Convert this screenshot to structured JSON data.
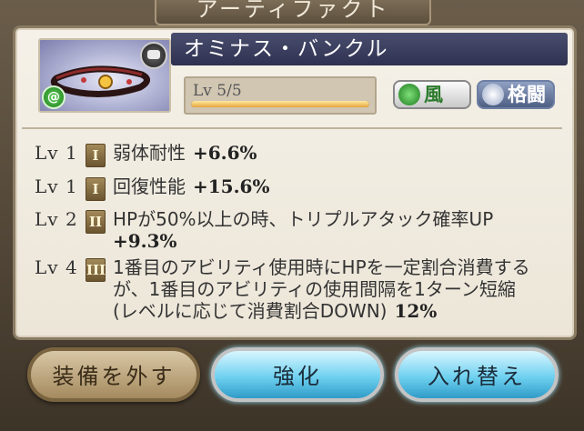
{
  "window_title": "アーティファクト",
  "item": {
    "name": "オミナス・バンクル",
    "level_label": "Lv 5/5",
    "level_progress": 1.0,
    "thumbnail_icon": "bangle-artifact-icon",
    "element_badge_icon": "wind-element-icon",
    "element_label": "風",
    "weapon_type_label": "格闘"
  },
  "skills": [
    {
      "lv": "Lv 1",
      "rank": "I",
      "desc": "弱体耐性",
      "value": "+6.6%"
    },
    {
      "lv": "Lv 1",
      "rank": "I",
      "desc": "回復性能",
      "value": "+15.6%"
    },
    {
      "lv": "Lv 2",
      "rank": "II",
      "desc": "HPが50%以上の時、トリプルアタック確率UP",
      "value": "+9.3%"
    },
    {
      "lv": "Lv 4",
      "rank": "III",
      "desc": "1番目のアビリティ使用時にHPを一定割合消費するが、1番目のアビリティの使用間隔を1ターン短縮(レベルに応じて消費割合DOWN)",
      "value": "12%"
    }
  ],
  "buttons": {
    "unequip": "装備を外す",
    "upgrade": "強化",
    "swap": "入れ替え"
  },
  "colors": {
    "header": "#2e3150",
    "panel": "#f2ede2",
    "button_blue": "#6fd1f0",
    "button_tan": "#a58a5e"
  }
}
